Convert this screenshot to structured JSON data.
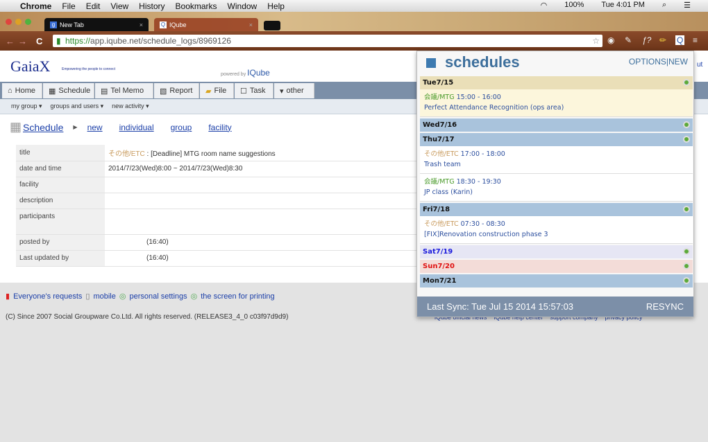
{
  "menubar": {
    "app": "Chrome",
    "items": [
      "File",
      "Edit",
      "View",
      "History",
      "Bookmarks",
      "Window",
      "Help"
    ],
    "battery": "100%",
    "clock": "Tue 4:01 PM"
  },
  "tabs": [
    {
      "label": "New Tab"
    },
    {
      "label": "IQube"
    }
  ],
  "address": {
    "scheme": "https://",
    "rest": "app.iqube.net/schedule_logs/8969126"
  },
  "site": {
    "logo": "GaiaX",
    "tagline": "Empowering the people to connect",
    "powered_by": "powered by",
    "powered_brand": "IQube",
    "logout_partial": "ut"
  },
  "nav_tabs": [
    "Home",
    "Schedule",
    "Tel Memo",
    "Report",
    "File",
    "Task",
    "other"
  ],
  "subnav": [
    "my group ▾",
    "groups and users ▾",
    "new activity ▾"
  ],
  "breadcrumb": {
    "title": "Schedule",
    "links": [
      "new",
      "individual",
      "group",
      "facility"
    ]
  },
  "detail": {
    "rows": [
      {
        "key": "title",
        "category": "その他/ETC",
        "value": " : [Deadline] MTG room name suggestions"
      },
      {
        "key": "date and time",
        "value": "2014/7/23(Wed)8:00 ~ 2014/7/23(Wed)8:30"
      },
      {
        "key": "facility",
        "value": ""
      },
      {
        "key": "description",
        "value": ""
      },
      {
        "key": "participants",
        "value": ""
      },
      {
        "key": "posted by",
        "value": "(16:40)"
      },
      {
        "key": "Last updated by",
        "value": "(16:40)"
      }
    ]
  },
  "footer": {
    "links": [
      "Everyone's requests",
      "mobile",
      "personal settings",
      "the screen for printing"
    ],
    "copyright": "(C) Since 2007 Social Groupware Co.Ltd. All rights reserved. (RELEASE3_4_0 c03f97d9d9)",
    "right_links": [
      "iQube official news",
      "iQube help center",
      "support company",
      "privacy policy"
    ]
  },
  "popup": {
    "title": "schedules",
    "options": "OPTIONS",
    "new": "NEW",
    "separator": "|",
    "days": [
      {
        "label": "Tue7/15",
        "bg": "#eadfb8",
        "color": "#111",
        "events": [
          {
            "category": "会議/MTG",
            "cat_color": "#4a9a2a",
            "time": "15:00 - 16:00",
            "name": "Perfect Attendance Recognition (ops area)",
            "bg": "#fcf6dc"
          }
        ]
      },
      {
        "label": "Wed7/16",
        "bg": "#a9c3dc",
        "color": "#111",
        "events": []
      },
      {
        "label": "Thu7/17",
        "bg": "#a9c3dc",
        "color": "#111",
        "events": [
          {
            "category": "その他/ETC",
            "cat_color": "#c89a5c",
            "time": "17:00 - 18:00",
            "name": "Trash team",
            "bg": "#fff"
          },
          {
            "category": "会議/MTG",
            "cat_color": "#4a9a2a",
            "time": "18:30 - 19:30",
            "name": "JP class (Karin)",
            "bg": "#fff"
          }
        ]
      },
      {
        "label": "Fri7/18",
        "bg": "#a9c3dc",
        "color": "#111",
        "events": [
          {
            "category": "その他/ETC",
            "cat_color": "#c89a5c",
            "time": "07:30 - 08:30",
            "name": "[FIX]Renovation construction phase 3",
            "bg": "#fff"
          }
        ]
      },
      {
        "label": "Sat7/19",
        "bg": "#e6e6f4",
        "color": "#1a1adc",
        "events": []
      },
      {
        "label": "Sun7/20",
        "bg": "#f3dcd8",
        "color": "#e01010",
        "events": []
      },
      {
        "label": "Mon7/21",
        "bg": "#a9c3dc",
        "color": "#111",
        "events": []
      }
    ],
    "last_sync": "Last Sync: Tue Jul 15 2014 15:57:03",
    "resync": "RESYNC"
  }
}
